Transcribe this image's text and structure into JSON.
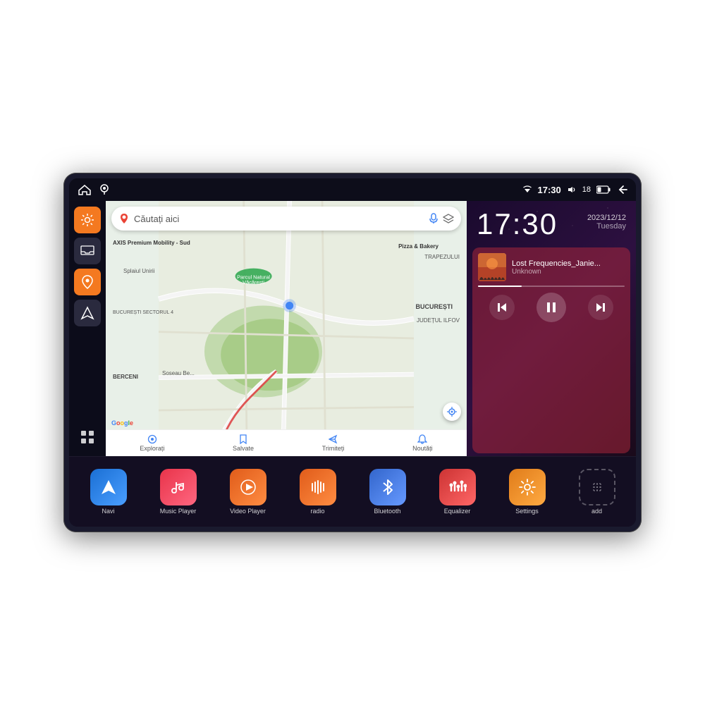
{
  "device": {
    "status_bar": {
      "wifi_icon": "▼",
      "time": "17:30",
      "volume_icon": "🔊",
      "battery_level": "18",
      "battery_icon": "🔋",
      "back_icon": "↩"
    },
    "clock": {
      "time": "17:30",
      "date": "2023/12/12",
      "day": "Tuesday"
    },
    "music": {
      "title": "Lost Frequencies_Janie...",
      "artist": "Unknown",
      "progress": 30
    },
    "map": {
      "search_placeholder": "Căutați aici",
      "location1": "AXIS Premium Mobility - Sud",
      "location2": "Pizza & Bakery",
      "location3": "Parcul Natural Văcărești",
      "area1": "BUCUREȘTI SECTORUL 4",
      "area2": "BUCUREȘTI",
      "area3": "JUDEȚUL ILFOV",
      "area4": "BERCENI",
      "area5": "TRAPEZULUI",
      "bottom": {
        "item1": "Explorați",
        "item2": "Salvate",
        "item3": "Trimiteți",
        "item4": "Noutăți"
      }
    },
    "apps": [
      {
        "id": "navi",
        "label": "Navi",
        "icon": "▲",
        "class": "app-navi"
      },
      {
        "id": "music-player",
        "label": "Music Player",
        "icon": "♪",
        "class": "app-music"
      },
      {
        "id": "video-player",
        "label": "Video Player",
        "icon": "▶",
        "class": "app-video"
      },
      {
        "id": "radio",
        "label": "radio",
        "icon": "📻",
        "class": "app-radio"
      },
      {
        "id": "bluetooth",
        "label": "Bluetooth",
        "icon": "⚡",
        "class": "app-bluetooth"
      },
      {
        "id": "equalizer",
        "label": "Equalizer",
        "icon": "📊",
        "class": "app-equalizer"
      },
      {
        "id": "settings",
        "label": "Settings",
        "icon": "⚙",
        "class": "app-settings"
      },
      {
        "id": "add",
        "label": "add",
        "icon": "+",
        "class": "app-add"
      }
    ],
    "sidebar": {
      "btn1_icon": "⚙",
      "btn2_icon": "📥",
      "btn3_icon": "📍",
      "btn4_icon": "▲",
      "btn5_icon": "⋮⋮⋮"
    },
    "controls": {
      "prev": "⏮",
      "pause": "⏸",
      "next": "⏭"
    }
  }
}
